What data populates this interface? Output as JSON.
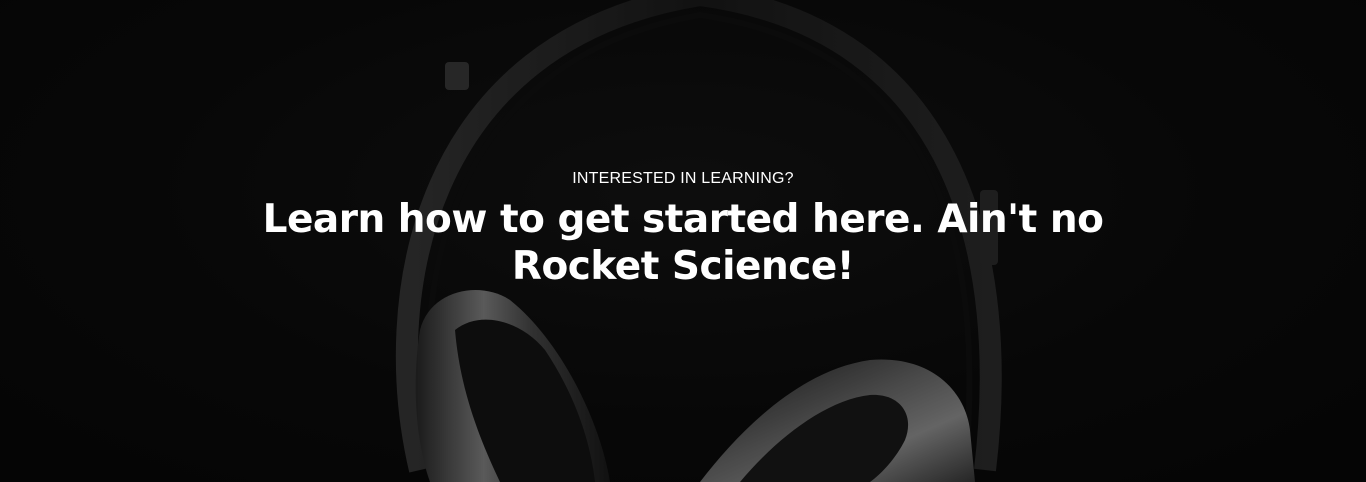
{
  "hero": {
    "eyebrow": "INTERESTED IN LEARNING?",
    "headline": "Learn how to get started here. Ain't no Rocket Science!",
    "background_image": "headphones-image",
    "colors": {
      "background": "#0b0b0b",
      "text": "#ffffff"
    }
  }
}
